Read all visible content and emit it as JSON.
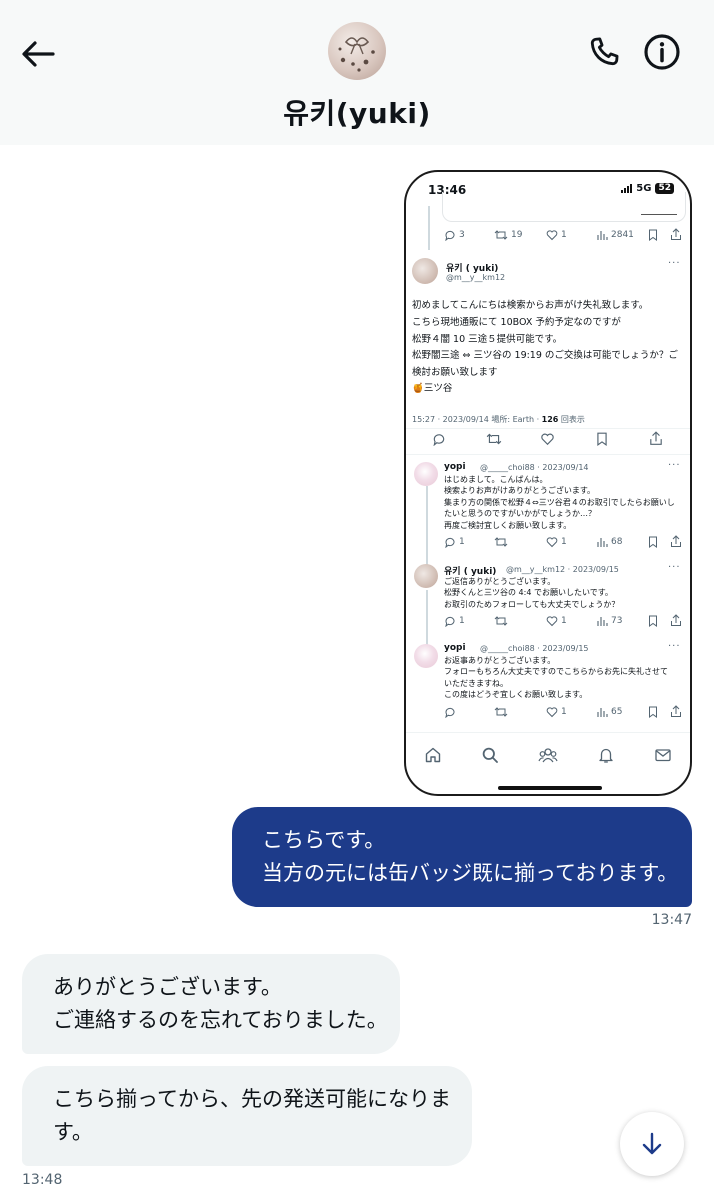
{
  "header": {
    "title": "유키(yuki)",
    "back_icon": "arrow-left-icon",
    "call_icon": "phone-icon",
    "info_icon": "info-icon"
  },
  "shared_screenshot": {
    "status_time": "13:46",
    "status_network": "5G",
    "status_battery": "52",
    "quoted_actions": {
      "replies": "3",
      "retweets": "19",
      "likes": "1",
      "views": "2841"
    },
    "main_post": {
      "name": "유키 ( yuki)",
      "handle": "@m__y__km12",
      "lines": [
        "初めましてこんにちは検索からお声がけ失礼致します。",
        "こちら現地通販にて 10BOX 予約予定なのですが",
        "松野４闇 10 三途５提供可能です。",
        "松野闇三途 ⇔ 三ツ谷の 19:19 のご交換は可能でしょうか？ご",
        "検討お願い致します",
        "🍯三ツ谷"
      ],
      "meta_prefix": "15:27 · 2023/09/14 場所: Earth · ",
      "meta_views": "126",
      "meta_suffix": " 回表示"
    },
    "replies": [
      {
        "name": "yopi",
        "handle": "@_____choi88 · 2023/09/14",
        "lines": [
          "はじめまして。こんばんは。",
          "検索よりお声がけありがとうございます。",
          "集まり方の関係で松野４⇔三ツ谷君４のお取引でしたらお願いし",
          "たいと思うのですがいかがでしょうか…？",
          "再度ご検討宜しくお願い致します。"
        ],
        "actions": {
          "replies": "1",
          "likes": "1",
          "views": "68"
        }
      },
      {
        "name": "유키 ( yuki)",
        "handle": "@m__y__km12 · 2023/09/15",
        "lines": [
          "ご返信ありがとうございます。",
          "松野くんと三ツ谷の 4:4 でお願いしたいです。",
          "お取引のためフォローしても大丈夫でしょうか？"
        ],
        "actions": {
          "replies": "1",
          "likes": "1",
          "views": "73"
        }
      },
      {
        "name": "yopi",
        "handle": "@_____choi88 · 2023/09/15",
        "lines": [
          "お返事ありがとうございます。",
          "フォローもちろん大丈夫ですのでこちらからお先に失礼させて",
          "いただきますね。",
          "この度はどうぞ宜しくお願い致します。"
        ],
        "actions": {
          "replies": "",
          "likes": "1",
          "views": "65"
        }
      }
    ]
  },
  "messages": {
    "outgoing": {
      "line1": "こちらです。",
      "line2": "当方の元には缶バッジ既に揃っております。",
      "time": "13:47"
    },
    "incoming1": {
      "line1": "ありがとうございます。",
      "line2": "ご連絡するのを忘れておりました。"
    },
    "incoming2": {
      "text": "こちら揃ってから、先の発送可能になります。"
    },
    "incoming_time": "13:48"
  },
  "scroll_down_icon": "arrow-down-icon",
  "colors": {
    "accent": "#1d3b8a",
    "incoming_bubble": "#eff3f4",
    "header_bg": "#f7f9f9"
  }
}
